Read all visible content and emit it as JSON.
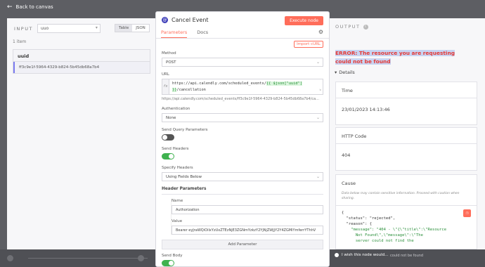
{
  "topbar": {
    "back_label": "Back to canvas"
  },
  "input_panel": {
    "label": "INPUT",
    "node_select": "uuo",
    "view_toggle": [
      "Table",
      "JSON"
    ],
    "item_count": "1 item",
    "table": {
      "header": "uuid",
      "rows": [
        "ff3c9e1f-5964-4329-b824-5b45db68a7b4"
      ]
    }
  },
  "node": {
    "title": "Cancel Event",
    "execute_label": "Execute node",
    "tabs": [
      "Parameters",
      "Docs"
    ],
    "import_label": "Import cURL",
    "method": {
      "label": "Method",
      "value": "POST"
    },
    "url": {
      "label": "URL",
      "line1_prefix": "https://api.calendly.com/scheduled_events/",
      "line1_expr": "{{ $json[\"uuid\"] ",
      "line2_expr": "}}",
      "line2_suffix": "/cancellation",
      "preview": "https://api.calendly.com/scheduled_events/ff3c9e1f-5964-4329-b824-5b45db68a7b4/ca..."
    },
    "authentication": {
      "label": "Authentication",
      "value": "None"
    },
    "send_query": {
      "label": "Send Query Parameters",
      "enabled": false
    },
    "send_headers": {
      "label": "Send Headers",
      "enabled": true
    },
    "specify_headers": {
      "label": "Specify Headers",
      "value": "Using Fields Below"
    },
    "header_params": {
      "title": "Header Parameters",
      "name_label": "Name",
      "name_value": "Authorization",
      "value_label": "Value",
      "value_value": "Bearer eyJraWQiOiIxYzUxZTEzNjE3ZGNmYzkzY2YjNjZWJjY2Y4ZGMiYmferrYThhV"
    },
    "add_param_label": "Add Parameter",
    "send_body": {
      "label": "Send Body",
      "enabled": true
    }
  },
  "output_panel": {
    "label": "OUTPUT",
    "error": "ERROR: The resource you are requesting could not be found",
    "details_label": "Details",
    "time": {
      "label": "Time",
      "value": "23/01/2023 14:13:46"
    },
    "http_code": {
      "label": "HTTP Code",
      "value": "404"
    },
    "cause": {
      "label": "Cause",
      "note": "Data below may contain sensitive information. Proceed with caution when sharing.",
      "json_lines": [
        "{",
        "  \"status\": \"rejected\",",
        "  \"reason\": {",
        "    \"message\": \"404 - \\\"{\\\"title\\\":\\\"Resource",
        "      Not Found\\\",\\\"message\\\":\\\"The",
        "      server could not find the"
      ]
    }
  },
  "footer": {
    "wish_label": "I wish this node would...",
    "hint": "could not be found"
  },
  "colors": {
    "accent": "#ff6d5a",
    "error": "#e53935",
    "switch_on": "#3fb24f"
  }
}
